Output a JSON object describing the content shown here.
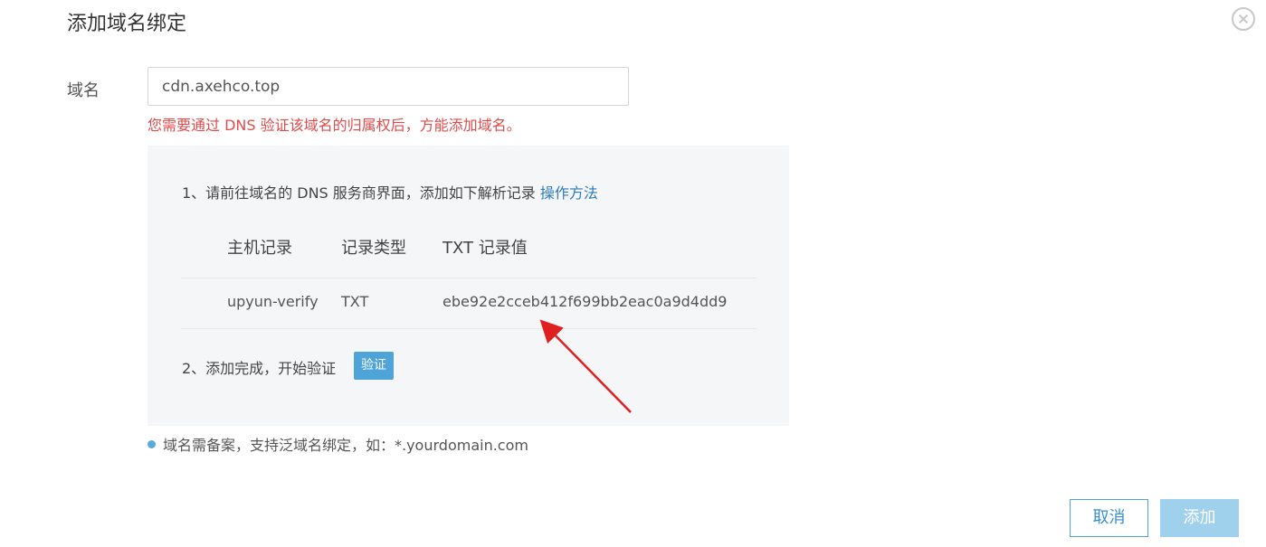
{
  "dialog": {
    "title": "添加域名绑定",
    "close_icon": "close-circle-icon"
  },
  "form": {
    "domain_label": "域名",
    "domain_value": "cdn.axehco.top",
    "error": "您需要通过 DNS 验证该域名的归属权后，方能添加域名。"
  },
  "instructions": {
    "step1_text": "1、请前往域名的 DNS 服务商界面，添加如下解析记录",
    "step1_link": "操作方法",
    "table": {
      "headers": [
        "主机记录",
        "记录类型",
        "TXT 记录值"
      ],
      "row": [
        "upyun-verify",
        "TXT",
        "ebe92e2cceb412f699bb2eac0a9d4dd9"
      ]
    },
    "step2_text": "2、添加完成，开始验证",
    "verify_label": "验证"
  },
  "note": "域名需备案，支持泛域名绑定，如：*.yourdomain.com",
  "footer": {
    "cancel_label": "取消",
    "add_label": "添加"
  },
  "colors": {
    "accent": "#4ea3d8",
    "error": "#e04b4b",
    "annotation_arrow": "#e02020"
  }
}
